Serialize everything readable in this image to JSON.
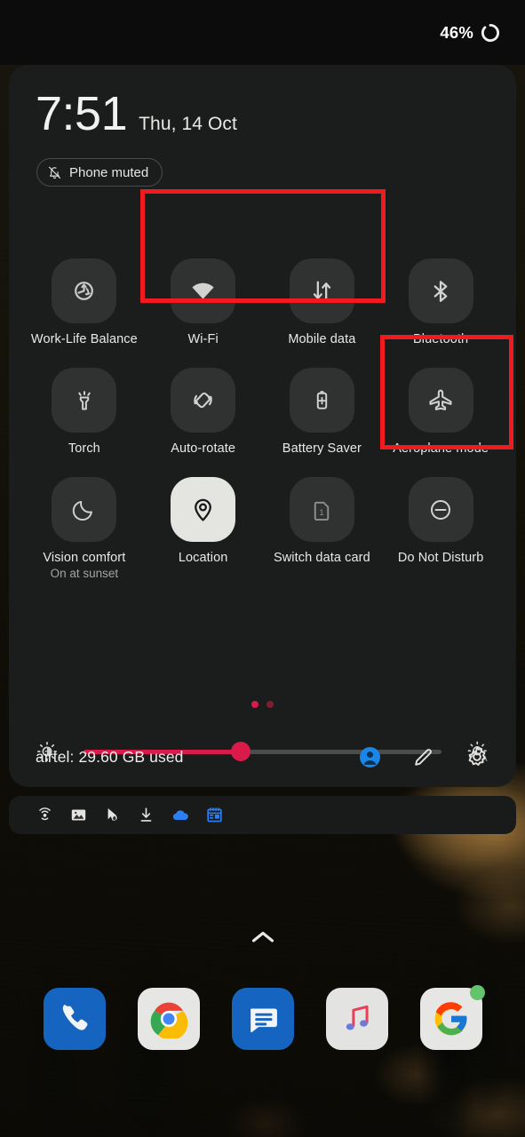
{
  "status_bar": {
    "battery_percent": "46%",
    "battery_icon": "battery-ring-icon"
  },
  "quick_settings": {
    "clock": {
      "time": "7:51",
      "date": "Thu, 14 Oct"
    },
    "mute_chip": {
      "label": "Phone muted",
      "icon": "bell-off-icon"
    },
    "tiles": [
      {
        "label": "Work-Life Balance",
        "icon": "work-life-balance-icon",
        "state": "off",
        "sub": ""
      },
      {
        "label": "Wi-Fi",
        "icon": "wifi-icon",
        "state": "off",
        "sub": ""
      },
      {
        "label": "Mobile data",
        "icon": "mobile-data-icon",
        "state": "off",
        "sub": ""
      },
      {
        "label": "Bluetooth",
        "icon": "bluetooth-icon",
        "state": "off",
        "sub": ""
      },
      {
        "label": "Torch",
        "icon": "torch-icon",
        "state": "off",
        "sub": ""
      },
      {
        "label": "Auto-rotate",
        "icon": "auto-rotate-icon",
        "state": "off",
        "sub": ""
      },
      {
        "label": "Battery Saver",
        "icon": "battery-saver-icon",
        "state": "off",
        "sub": ""
      },
      {
        "label": "Aeroplane mode",
        "icon": "aeroplane-icon",
        "state": "off",
        "sub": ""
      },
      {
        "label": "Vision comfort",
        "icon": "moon-icon",
        "state": "off",
        "sub": "On at sunset"
      },
      {
        "label": "Location",
        "icon": "location-pin-icon",
        "state": "on",
        "sub": ""
      },
      {
        "label": "Switch data card",
        "icon": "sim-card-1-icon",
        "state": "off",
        "sub": ""
      },
      {
        "label": "Do Not Disturb",
        "icon": "do-not-disturb-icon",
        "state": "off",
        "sub": ""
      }
    ],
    "page_dots": {
      "count": 2,
      "active_index": 0
    },
    "brightness": {
      "value_percent": 44,
      "low_icon": "brightness-low-icon",
      "auto_icon": "brightness-auto-icon"
    },
    "footer": {
      "carrier_usage": "airtel: 29.60 GB used",
      "icons": [
        "user-avatar-icon",
        "edit-pencil-icon",
        "settings-gear-icon"
      ]
    }
  },
  "notification_strip": {
    "icons": [
      "cast-icon",
      "image-icon",
      "app-cursor-icon",
      "download-icon",
      "cloud-icon",
      "calendar-icon"
    ]
  },
  "home": {
    "drawer_indicator": "chevron-up-icon",
    "dock_apps": [
      {
        "name": "Phone",
        "icon": "phone-icon",
        "badge": false
      },
      {
        "name": "Chrome",
        "icon": "chrome-icon",
        "badge": false
      },
      {
        "name": "Messages",
        "icon": "messages-icon",
        "badge": false
      },
      {
        "name": "Music",
        "icon": "music-icon",
        "badge": false
      },
      {
        "name": "Google",
        "icon": "google-icon",
        "badge": true
      }
    ]
  },
  "annotations": [
    {
      "name": "wifi-mobile-data-highlight",
      "color": "#f11a1f"
    },
    {
      "name": "aeroplane-mode-highlight",
      "color": "#f11a1f"
    }
  ],
  "colors": {
    "accent_slider": "#d81b4a",
    "tile_off_bg": "#303231",
    "tile_on_bg": "#e4e4e1",
    "panel_bg": "#1b1c1c",
    "annotation_red": "#f11a1f"
  }
}
